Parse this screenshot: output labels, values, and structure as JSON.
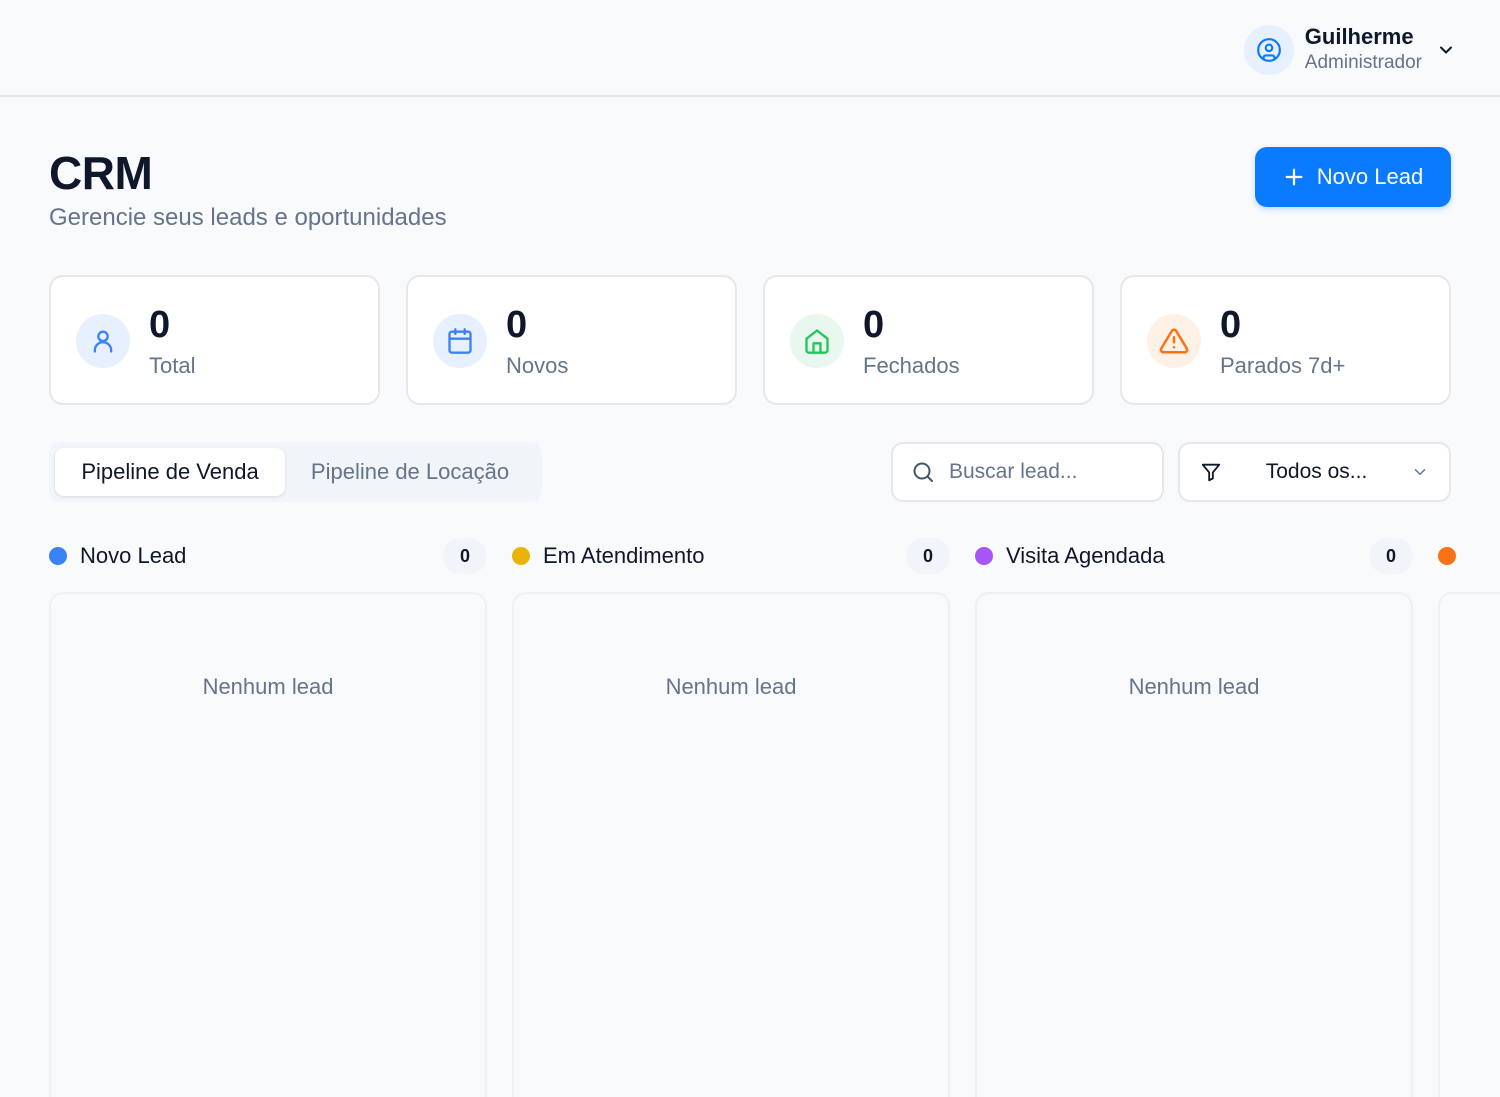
{
  "user": {
    "name": "Guilherme",
    "role": "Administrador"
  },
  "header": {
    "title": "CRM",
    "subtitle": "Gerencie seus leads e oportunidades",
    "new_lead_label": "Novo Lead"
  },
  "stats": [
    {
      "value": "0",
      "label": "Total",
      "icon": "user-icon",
      "color": "#3b82f6",
      "bg": "#e6f0fe"
    },
    {
      "value": "0",
      "label": "Novos",
      "icon": "calendar-icon",
      "color": "#3b82f6",
      "bg": "#e6f0fe"
    },
    {
      "value": "0",
      "label": "Fechados",
      "icon": "home-icon",
      "color": "#22c55e",
      "bg": "#e8f8ee"
    },
    {
      "value": "0",
      "label": "Parados 7d+",
      "icon": "warning-icon",
      "color": "#f97316",
      "bg": "#fff1e6"
    }
  ],
  "tabs": [
    {
      "label": "Pipeline de Venda",
      "active": true
    },
    {
      "label": "Pipeline de Locação",
      "active": false
    }
  ],
  "search": {
    "placeholder": "Buscar lead..."
  },
  "filter": {
    "selected": "Todos os..."
  },
  "columns": [
    {
      "title": "Novo Lead",
      "count": "0",
      "color": "#3b82f6",
      "empty_text": "Nenhum lead"
    },
    {
      "title": "Em Atendimento",
      "count": "0",
      "color": "#eab308",
      "empty_text": "Nenhum lead"
    },
    {
      "title": "Visita Agendada",
      "count": "0",
      "color": "#a855f7",
      "empty_text": "Nenhum lead"
    },
    {
      "title": "",
      "count": "",
      "color": "#f97316",
      "empty_text": ""
    }
  ],
  "colors": {
    "accent": "#0a7aff"
  }
}
